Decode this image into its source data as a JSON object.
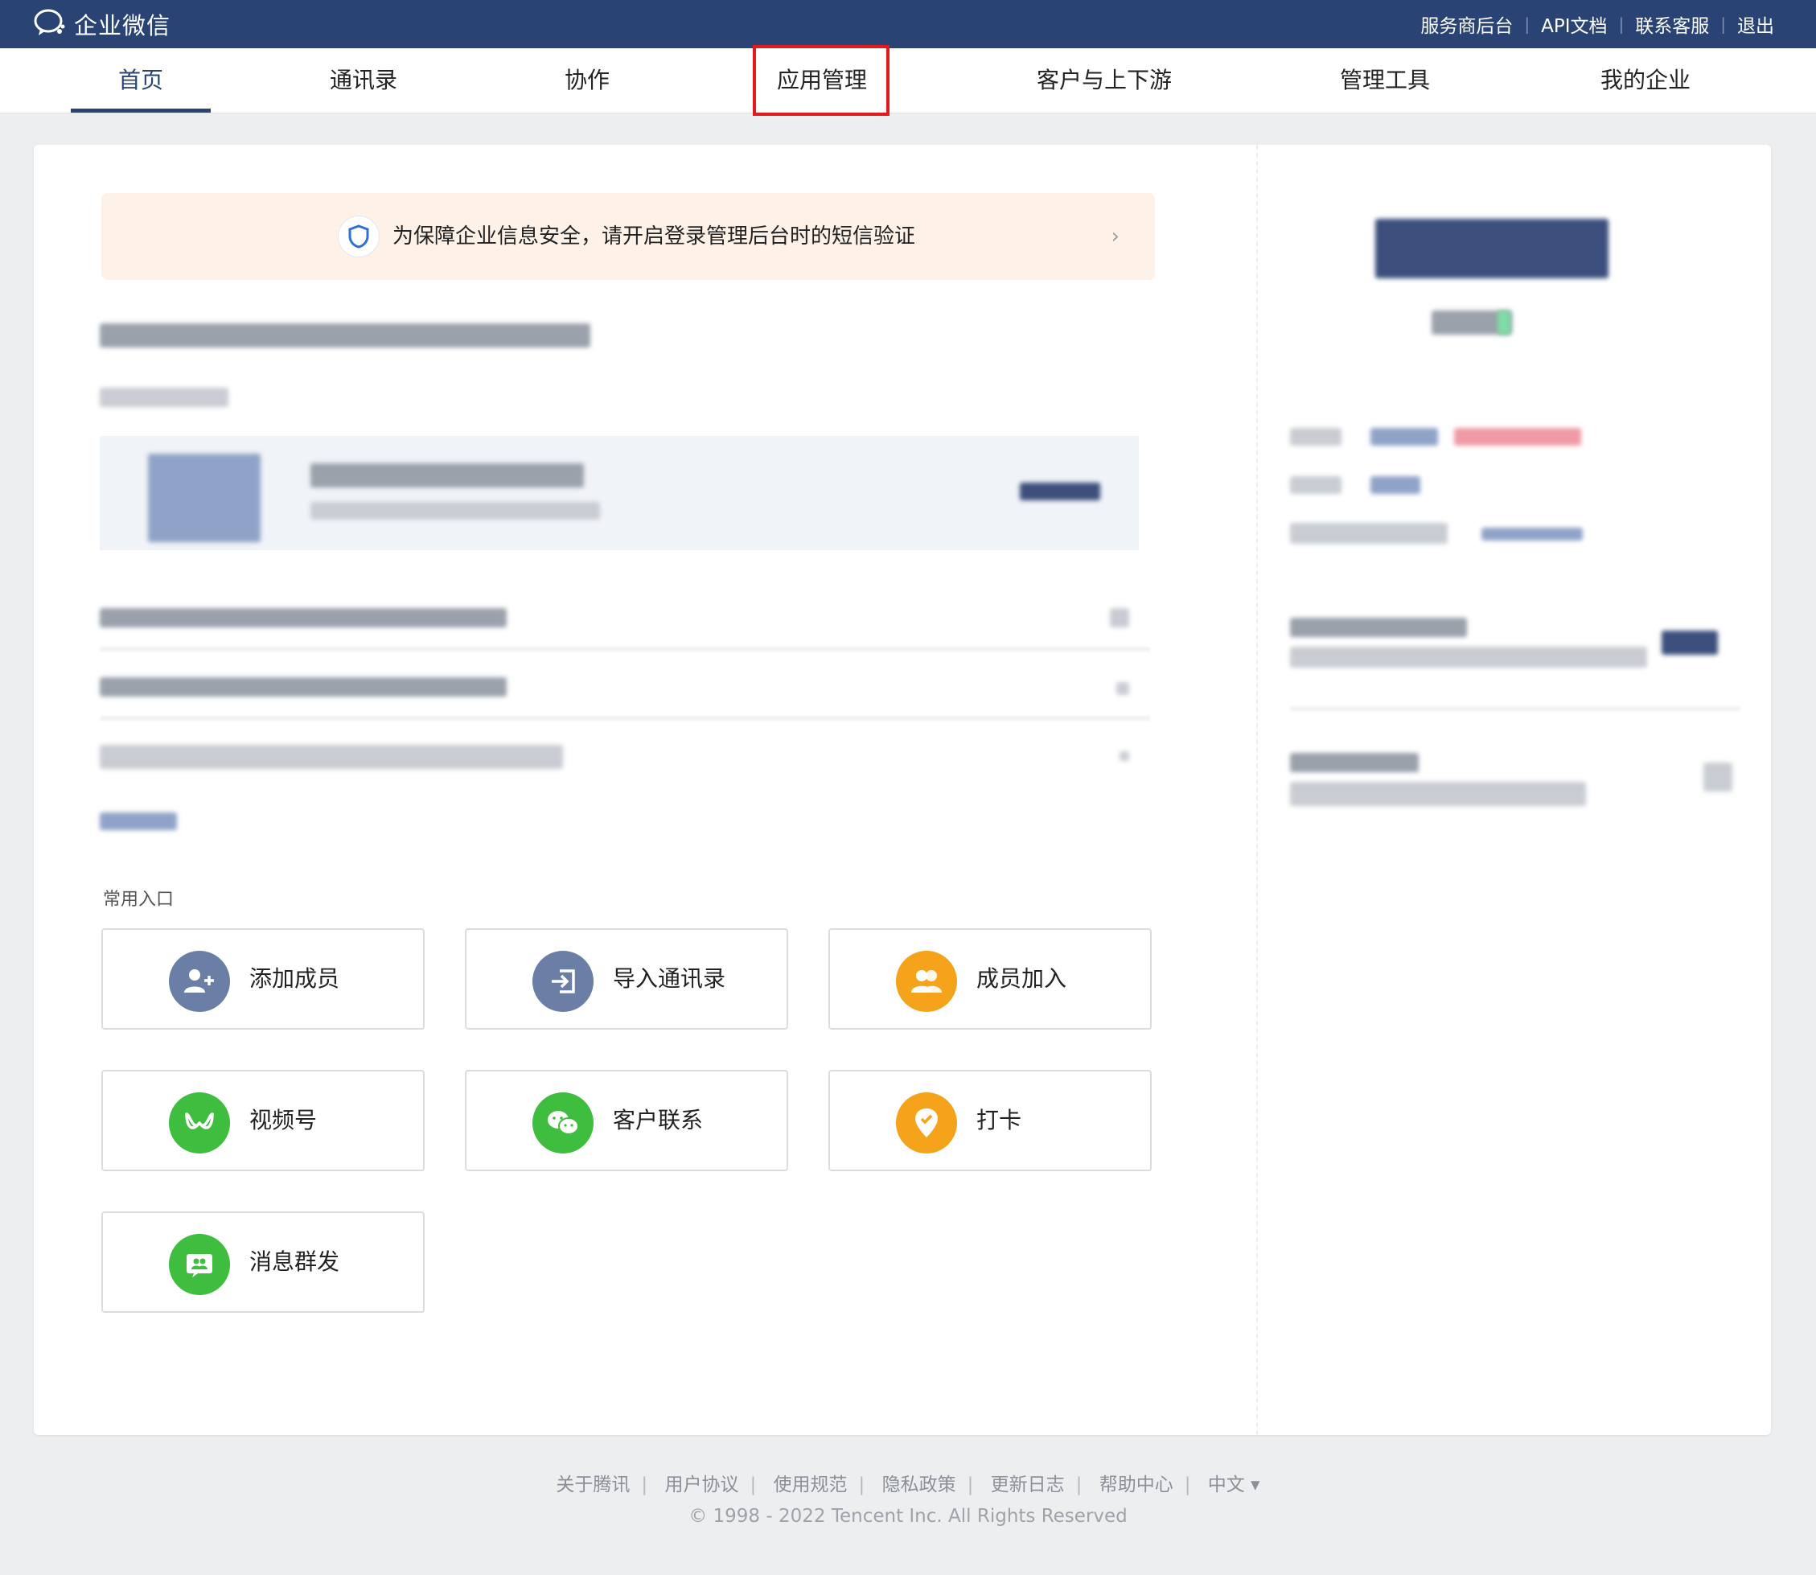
{
  "topbar": {
    "brand": "企业微信",
    "links": [
      "服务商后台",
      "API文档",
      "联系客服",
      "退出"
    ]
  },
  "nav": {
    "tabs": [
      "首页",
      "通讯录",
      "协作",
      "应用管理",
      "客户与上下游",
      "管理工具",
      "我的企业"
    ],
    "active": "首页",
    "highlighted": "应用管理"
  },
  "notice": {
    "text": "为保障企业信息安全，请开启登录管理后台时的短信验证",
    "chevron": "›"
  },
  "common": {
    "title": "常用入口",
    "entries": [
      {
        "label": "添加成员",
        "icon": "add-user-icon",
        "color": "#6b7fa6"
      },
      {
        "label": "导入通讯录",
        "icon": "import-icon",
        "color": "#6b7fa6"
      },
      {
        "label": "成员加入",
        "icon": "members-icon",
        "color": "#f4a31a"
      },
      {
        "label": "视频号",
        "icon": "channels-icon",
        "color": "#3fbd3f"
      },
      {
        "label": "客户联系",
        "icon": "wechat-chat-icon",
        "color": "#3fbd3f"
      },
      {
        "label": "打卡",
        "icon": "location-check-icon",
        "color": "#f4a31a"
      },
      {
        "label": "消息群发",
        "icon": "broadcast-icon",
        "color": "#3fbd3f"
      }
    ]
  },
  "footer": {
    "links": [
      "关于腾讯",
      "用户协议",
      "使用规范",
      "隐私政策",
      "更新日志",
      "帮助中心",
      "中文 ▾"
    ],
    "copyright": "© 1998 - 2022 Tencent Inc. All Rights Reserved"
  },
  "colors": {
    "header_bg": "#294474",
    "highlight": "#e3191c",
    "notice_bg": "#fdf1e8"
  }
}
